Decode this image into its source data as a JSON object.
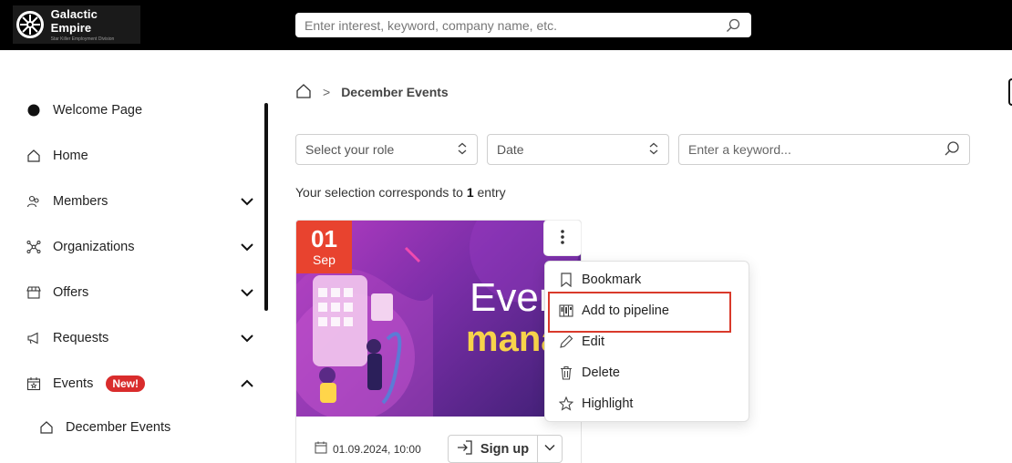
{
  "header": {
    "logo_title": "Galactic Empire",
    "logo_subtitle": "Star Killer Employment Division",
    "search_placeholder": "Enter interest, keyword, company name, etc."
  },
  "sidebar": {
    "items": [
      {
        "label": "Welcome Page",
        "icon": "dot-icon"
      },
      {
        "label": "Home",
        "icon": "home-icon"
      },
      {
        "label": "Members",
        "icon": "members-icon",
        "expand": "chevron-down"
      },
      {
        "label": "Organizations",
        "icon": "organizations-icon",
        "expand": "chevron-down"
      },
      {
        "label": "Offers",
        "icon": "store-icon",
        "expand": "chevron-down"
      },
      {
        "label": "Requests",
        "icon": "megaphone-icon",
        "expand": "chevron-down"
      },
      {
        "label": "Events",
        "icon": "calendar-star-icon",
        "badge": "New!",
        "expand": "chevron-up"
      },
      {
        "label": "December Events",
        "icon": "home-icon"
      }
    ]
  },
  "breadcrumb": {
    "separator": ">",
    "current": "December Events"
  },
  "filters": {
    "role_placeholder": "Select your role",
    "date_placeholder": "Date",
    "keyword_placeholder": "Enter a keyword..."
  },
  "result": {
    "prefix": "Your selection corresponds to ",
    "count": "1",
    "suffix": " entry"
  },
  "card": {
    "day": "01",
    "month": "Sep",
    "image_text_1": "Even",
    "image_text_2": "mana",
    "date_time": "01.09.2024, 10:00",
    "signup_label": "Sign up"
  },
  "menu": {
    "items": [
      {
        "label": "Bookmark",
        "icon": "bookmark-icon"
      },
      {
        "label": "Add to pipeline",
        "icon": "pipeline-icon"
      },
      {
        "label": "Edit",
        "icon": "pencil-icon"
      },
      {
        "label": "Delete",
        "icon": "trash-icon"
      },
      {
        "label": "Highlight",
        "icon": "star-icon"
      }
    ]
  },
  "colors": {
    "topbar": "#000000",
    "badge": "#d92c2c",
    "date_badge": "#e8432f",
    "highlight_border": "#d93a2b",
    "image_text_accent": "#f7d34a"
  }
}
